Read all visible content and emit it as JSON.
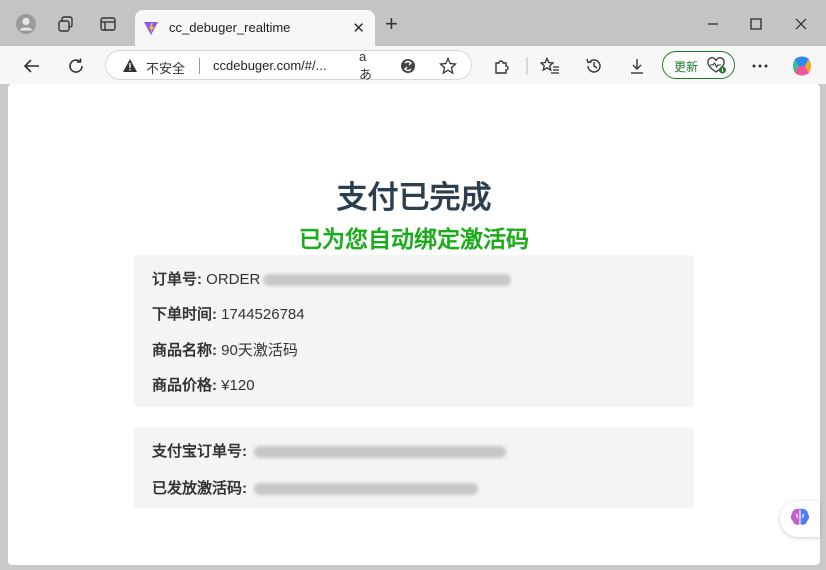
{
  "browser": {
    "tab_title": "cc_debuger_realtime",
    "insecure_label": "不安全",
    "url": "ccdebuger.com/#/...",
    "update_label": "更新"
  },
  "page": {
    "title": "支付已完成",
    "subtitle": "已为您自动绑定激活码",
    "order": {
      "order_no_label": "订单号:",
      "order_no_value": "ORDER",
      "order_time_label": "下单时间:",
      "order_time_value": "1744526784",
      "product_name_label": "商品名称:",
      "product_name_value": "90天激活码",
      "product_price_label": "商品价格:",
      "product_price_value": "¥120"
    },
    "payment": {
      "alipay_no_label": "支付宝订单号:",
      "activation_code_label": "已发放激活码:"
    }
  },
  "colors": {
    "title": "#2c3e50",
    "subtitle": "#1aad19",
    "card_bg": "#f4f4f4",
    "update_accent": "#1c7c2e"
  }
}
